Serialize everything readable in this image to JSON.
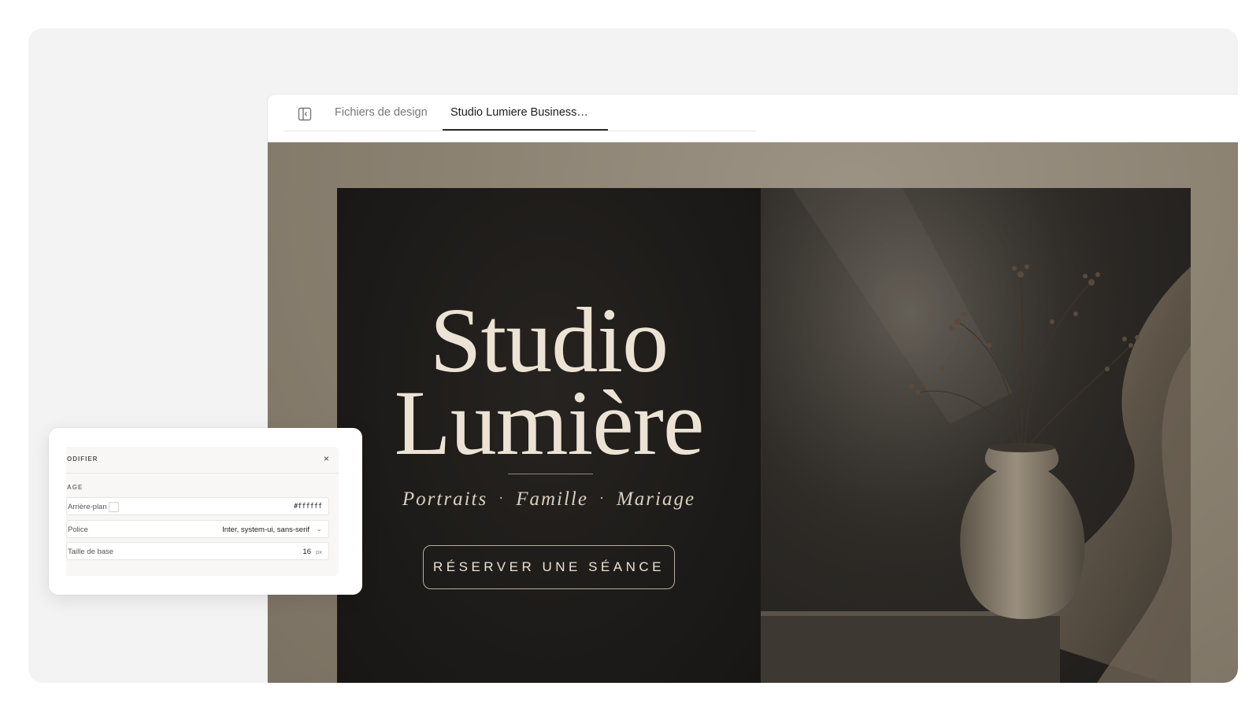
{
  "tabs": {
    "design_files": "Fichiers de design",
    "active": "Studio Lumiere Business…"
  },
  "hero": {
    "title_line1": "Studio",
    "title_line2": "Lumière",
    "tag1": "Portraits",
    "tag2": "Famille",
    "tag3": "Mariage",
    "separator": "·",
    "cta": "RÉSERVER UNE SÉANCE"
  },
  "panel": {
    "title": "ODIFIER",
    "close": "×",
    "section": "AGE",
    "background_label": "Arrière-plan",
    "background_value": "#ffffff",
    "font_label": "Police",
    "font_value": "Inter, system-ui, sans-serif",
    "size_label": "Taille de base",
    "size_value": "16",
    "size_unit": "px"
  },
  "icons": {
    "sidebar_toggle": "sidebar-toggle-icon",
    "dropdown": "chevron-down-icon"
  },
  "colors": {
    "hero_dark": "#1d1b19",
    "cream_text": "#ece3d4",
    "canvas_taupe": "#8d8373"
  }
}
